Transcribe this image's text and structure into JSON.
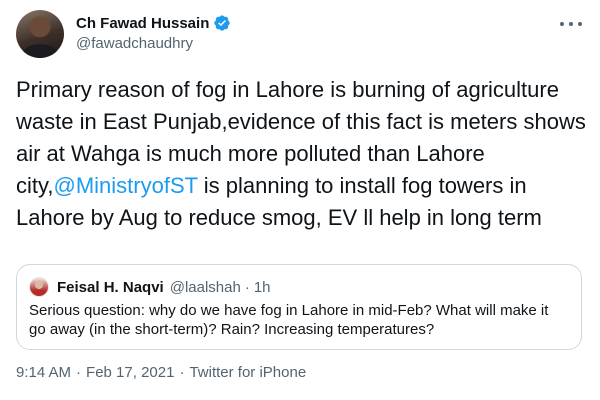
{
  "author": {
    "display_name": "Ch Fawad Hussain",
    "handle": "@fawadchaudhry",
    "verified": true
  },
  "tweet": {
    "text_before": "Primary reason of fog in Lahore is burning of agriculture waste in East Punjab,evidence of this fact is meters shows air at Wahga is much more polluted than Lahore city,",
    "mention": "@MinistryofST",
    "text_after": " is planning to install fog towers in Lahore by Aug to reduce smog, EV ll help in long term"
  },
  "quoted_tweet": {
    "display_name": "Feisal H. Naqvi",
    "handle": "@laalshah",
    "separator": "·",
    "time": "1h",
    "text": "Serious question: why do we have fog in Lahore in mid-Feb? What will make it go away (in the short-term)? Rain? Increasing temperatures?"
  },
  "meta": {
    "time": "9:14 AM",
    "separator": "·",
    "date": "Feb 17, 2021",
    "source": "Twitter for iPhone"
  },
  "colors": {
    "accent": "#1d9bf0",
    "text_primary": "#0f1419",
    "text_secondary": "#536471",
    "border": "#cfd9de"
  },
  "icons": {
    "verified": "verified-badge-icon",
    "more": "more-options-icon"
  }
}
